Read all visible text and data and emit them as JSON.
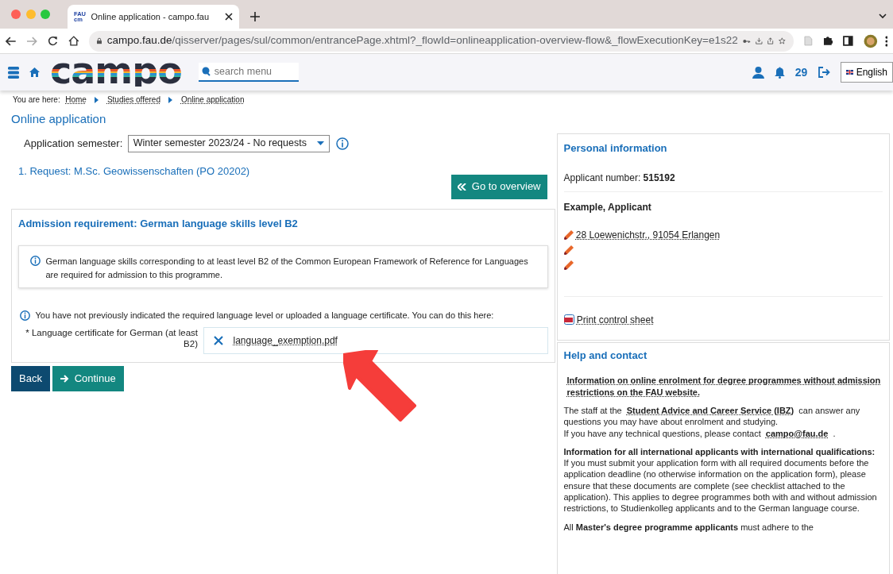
{
  "browser": {
    "tab_title": "Online application - campo.fau",
    "favicon_lines": [
      "FAU",
      "cm"
    ],
    "url_host": "campo.fau.de",
    "url_path": "/qisserver/pages/sul/common/entrancePage.xhtml?_flowId=onlineapplication-overview-flow&_flowExecutionKey=e1s22"
  },
  "header": {
    "logo": "campo",
    "search": {
      "placeholder": "search menu"
    },
    "notification_count": "29",
    "language": "English"
  },
  "breadcrumb": {
    "label": "You are here:",
    "items": [
      "Home",
      "Studies offered",
      "Online application"
    ]
  },
  "page_title": "Online application",
  "semester": {
    "label": "Application semester:",
    "value": "Winter semester 2023/24 - No requests"
  },
  "request_title": "1. Request: M.Sc. Geowissenschaften (PO 20202)",
  "overview_button": "Go to overview",
  "requirement": {
    "title": "Admission requirement: German language skills level B2",
    "info": "German language skills corresponding to at least level B2 of the Common European Framework of Reference for Languages are required for admission to this programme.",
    "notice": "You have not previously indicated the required language level or uploaded a language certificate. You can do this here:",
    "field_label": "* Language certificate for German (at least B2)",
    "file_name": "language_exemption.pdf"
  },
  "buttons": [
    {
      "label": "Back",
      "kind": "back"
    },
    {
      "label": "Continue",
      "kind": "continue"
    }
  ],
  "personal": {
    "title": "Personal information",
    "applicant_label": "Applicant number:",
    "applicant_number": "515192",
    "name": "Example, Applicant",
    "edit_entries": [
      {
        "kind": "address",
        "text": "28 Loewenichstr., 91054 Erlangen"
      },
      {
        "kind": "empty"
      },
      {
        "kind": "empty"
      }
    ],
    "print_link": "Print control sheet"
  },
  "help": {
    "title": "Help and contact",
    "blocks": [
      {
        "kind": "link",
        "text": "Information on online enrolment for degree programmes without admission restrictions on the FAU website."
      },
      {
        "kind": "mixed",
        "segments": [
          {
            "kind": "text",
            "text": "The staff at the "
          },
          {
            "kind": "link",
            "text": "Student Advice and Career Service (IBZ)"
          },
          {
            "kind": "text",
            "text": " can answer any questions you may have about enrolment and studying."
          },
          {
            "kind": "break"
          },
          {
            "kind": "text",
            "text": "If you have any technical questions, please contact "
          },
          {
            "kind": "link",
            "text": "campo@fau.de"
          },
          {
            "kind": "text",
            "text": " ."
          }
        ]
      },
      {
        "kind": "heading",
        "text": "Information for all international applicants with international qualifications:"
      },
      {
        "kind": "text",
        "text": "If you must submit your application form with all required documents before the application deadline (no otherwise information on the application form), please ensure that these documents are complete (see checklist attached to the application). This applies to degree programmes both with and without admission restrictions, to Studienkolleg applicants and to the German language course."
      },
      {
        "kind": "text",
        "text": "All **Master's degree programme applicants** must adhere to the"
      }
    ]
  }
}
